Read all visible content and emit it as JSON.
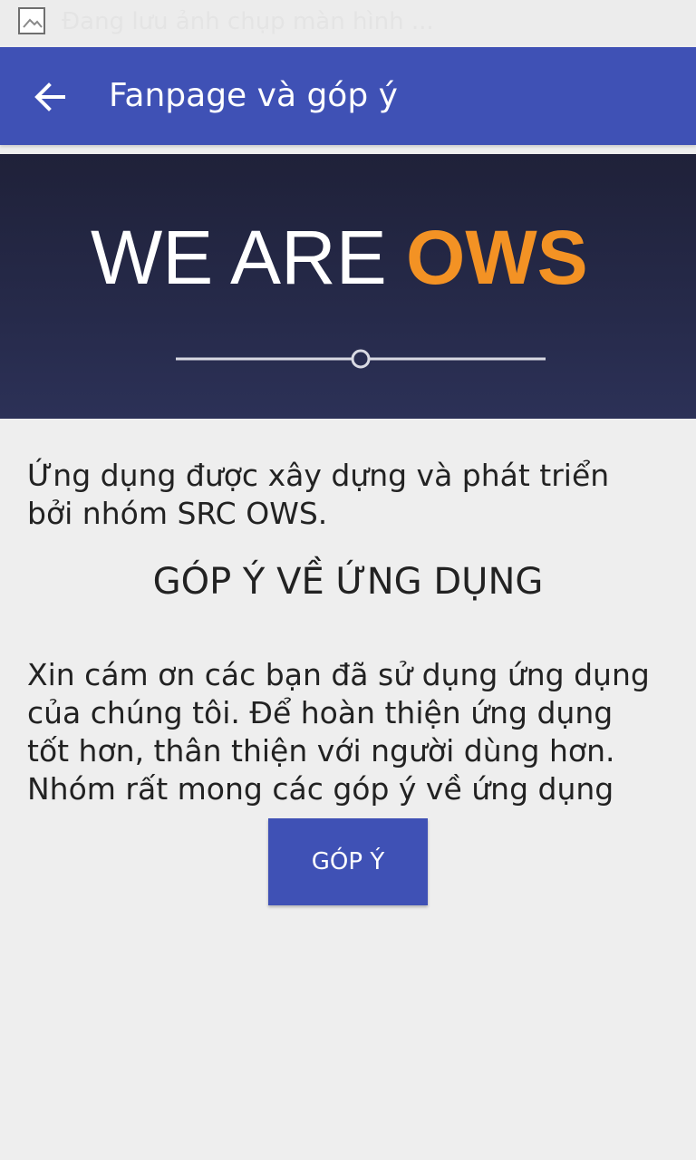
{
  "status_bar": {
    "notification_text": "Đang lưu ảnh chụp màn hình ...",
    "icon": "image-icon"
  },
  "app_bar": {
    "title": "Fanpage và góp ý",
    "back_icon": "arrow-left-icon",
    "color": "#3f51b5"
  },
  "banner": {
    "text_white": "WE ARE",
    "text_orange": "OWS",
    "orange_color": "#f39224"
  },
  "content": {
    "intro": "Ứng dụng được xây dựng và phát triển bởi nhóm SRC OWS.",
    "heading": "GÓP Ý VỀ ỨNG DỤNG",
    "thanks": "Xin cám ơn các bạn đã sử dụng ứng dụng của chúng tôi. Để hoàn thiện ứng dụng tốt hơn, thân thiện với người dùng hơn. Nhóm rất mong các góp ý về ứng dụng",
    "button_label": "GÓP Ý"
  }
}
